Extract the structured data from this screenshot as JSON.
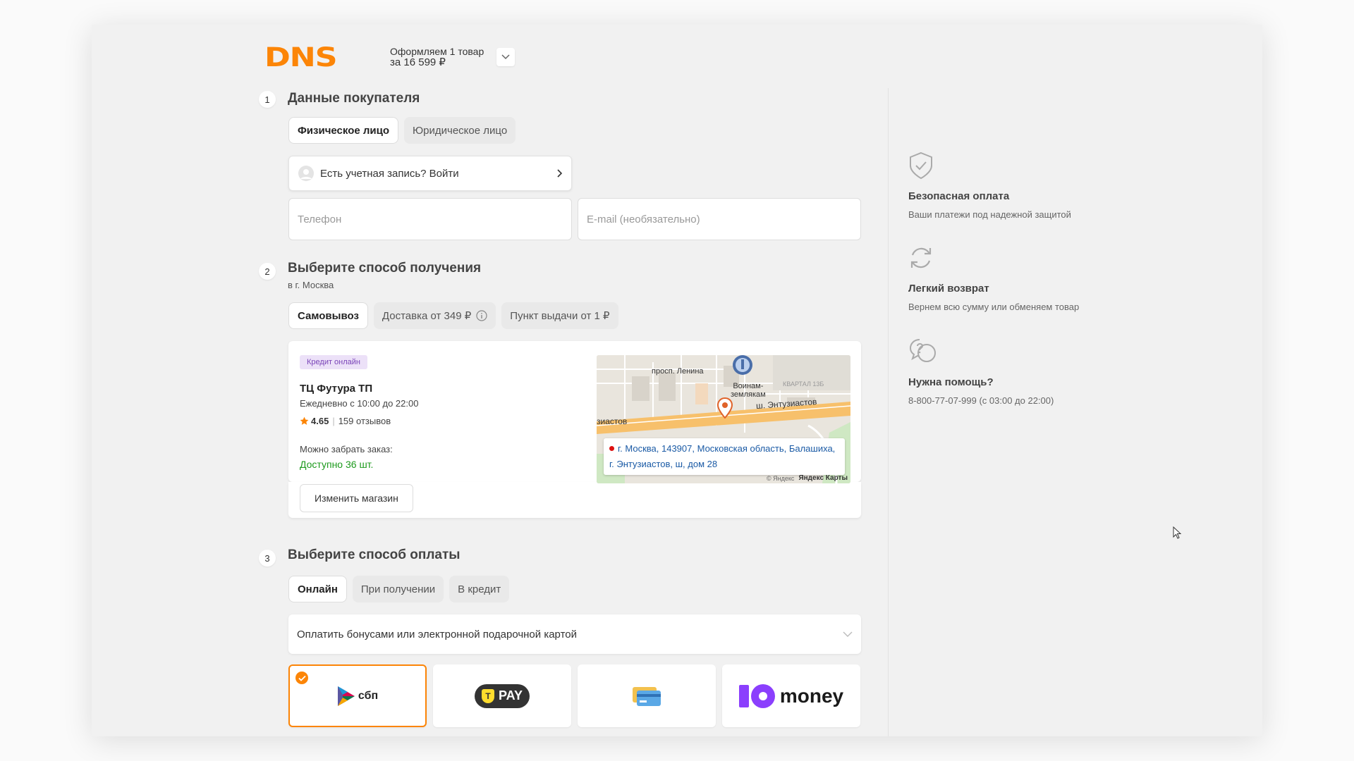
{
  "header": {
    "logo": "DNS",
    "order_line1": "Оформляем 1 товар",
    "order_line2": "за 16 599 ₽"
  },
  "step1": {
    "num": "1",
    "title": "Данные покупателя",
    "tabs": [
      "Физическое лицо",
      "Юридическое лицо"
    ],
    "login_text": "Есть учетная запись? Войти",
    "phone_placeholder": "Телефон",
    "email_placeholder": "E-mail (необязательно)"
  },
  "step2": {
    "num": "2",
    "title": "Выберите способ получения",
    "subtitle": "в г. Москва",
    "tabs": [
      "Самовывоз",
      "Доставка от 349 ₽",
      "Пункт выдачи от 1 ₽"
    ],
    "store": {
      "badge": "Кредит онлайн",
      "name": "ТЦ Футура ТП",
      "hours": "Ежедневно с 10:00 до 22:00",
      "rating": "4.65",
      "reviews": "159 отзывов",
      "pickup_label": "Можно забрать заказ:",
      "availability": "Доступно 36 шт.",
      "change_button": "Изменить магазин",
      "address_line1": "г. Москва, 143907, Московская область, Балашиха,",
      "address_line2": "г. Энтузиастов, ш, дом 28"
    },
    "map": {
      "label_lenina": "просп. Ленина",
      "label_voin1": "Воинам-",
      "label_voin2": "землякам",
      "label_kvartal": "КВАРТАЛ 13Б",
      "label_shosse": "ш. Энтузиастов",
      "label_left": "зиастов",
      "copyright": "© Яндекс",
      "brand": "Яндекс Карты"
    }
  },
  "step3": {
    "num": "3",
    "title": "Выберите способ оплаты",
    "tabs": [
      "Онлайн",
      "При получении",
      "В кредит"
    ],
    "bonus_text": "Оплатить бонусами или электронной подарочной картой",
    "methods": {
      "sbp": "сбп",
      "tpay": "PAY",
      "tpay_logo": "T",
      "yoomoney": "money"
    }
  },
  "benefits": [
    {
      "title": "Безопасная оплата",
      "text": "Ваши платежи под надежной защитой"
    },
    {
      "title": "Легкий возврат",
      "text": "Вернем всю сумму или обменяем товар"
    },
    {
      "title": "Нужна помощь?",
      "text": "8-800-77-07-999 (с 03:00 до 22:00)"
    }
  ],
  "colors": {
    "brand": "#fc8507",
    "available": "#1c9a1c",
    "link": "#1a5aa5",
    "badge_bg": "#ece1f8",
    "badge_text": "#7a44b8"
  },
  "icons": [
    "chevron-down-icon",
    "user-icon",
    "chevron-right-icon",
    "info-icon",
    "star-icon",
    "shield-check-icon",
    "refresh-icon",
    "help-chat-icon",
    "check-icon",
    "map-pin-icon",
    "mouse-cursor-icon"
  ]
}
